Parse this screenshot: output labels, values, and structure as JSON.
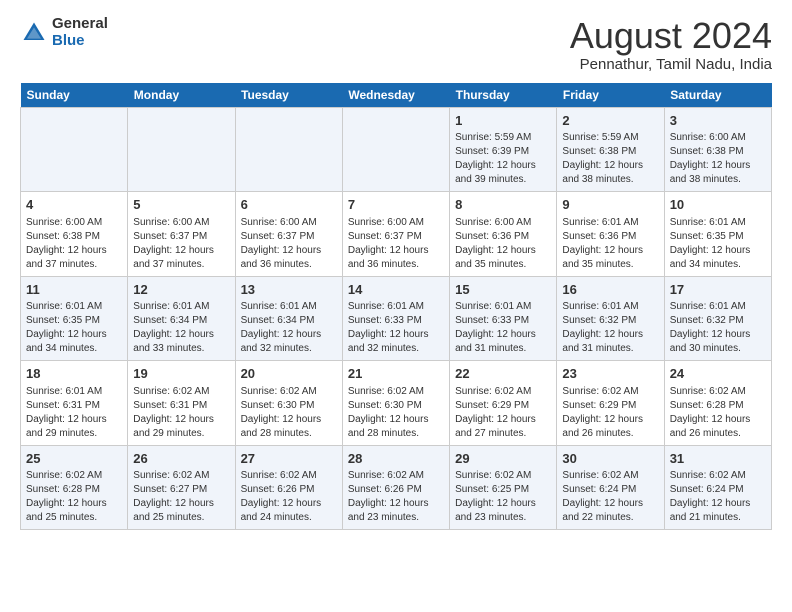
{
  "logo": {
    "general": "General",
    "blue": "Blue"
  },
  "header": {
    "title": "August 2024",
    "subtitle": "Pennathur, Tamil Nadu, India"
  },
  "weekdays": [
    "Sunday",
    "Monday",
    "Tuesday",
    "Wednesday",
    "Thursday",
    "Friday",
    "Saturday"
  ],
  "weeks": [
    [
      {
        "day": "",
        "info": ""
      },
      {
        "day": "",
        "info": ""
      },
      {
        "day": "",
        "info": ""
      },
      {
        "day": "",
        "info": ""
      },
      {
        "day": "1",
        "info": "Sunrise: 5:59 AM\nSunset: 6:39 PM\nDaylight: 12 hours\nand 39 minutes."
      },
      {
        "day": "2",
        "info": "Sunrise: 5:59 AM\nSunset: 6:38 PM\nDaylight: 12 hours\nand 38 minutes."
      },
      {
        "day": "3",
        "info": "Sunrise: 6:00 AM\nSunset: 6:38 PM\nDaylight: 12 hours\nand 38 minutes."
      }
    ],
    [
      {
        "day": "4",
        "info": "Sunrise: 6:00 AM\nSunset: 6:38 PM\nDaylight: 12 hours\nand 37 minutes."
      },
      {
        "day": "5",
        "info": "Sunrise: 6:00 AM\nSunset: 6:37 PM\nDaylight: 12 hours\nand 37 minutes."
      },
      {
        "day": "6",
        "info": "Sunrise: 6:00 AM\nSunset: 6:37 PM\nDaylight: 12 hours\nand 36 minutes."
      },
      {
        "day": "7",
        "info": "Sunrise: 6:00 AM\nSunset: 6:37 PM\nDaylight: 12 hours\nand 36 minutes."
      },
      {
        "day": "8",
        "info": "Sunrise: 6:00 AM\nSunset: 6:36 PM\nDaylight: 12 hours\nand 35 minutes."
      },
      {
        "day": "9",
        "info": "Sunrise: 6:01 AM\nSunset: 6:36 PM\nDaylight: 12 hours\nand 35 minutes."
      },
      {
        "day": "10",
        "info": "Sunrise: 6:01 AM\nSunset: 6:35 PM\nDaylight: 12 hours\nand 34 minutes."
      }
    ],
    [
      {
        "day": "11",
        "info": "Sunrise: 6:01 AM\nSunset: 6:35 PM\nDaylight: 12 hours\nand 34 minutes."
      },
      {
        "day": "12",
        "info": "Sunrise: 6:01 AM\nSunset: 6:34 PM\nDaylight: 12 hours\nand 33 minutes."
      },
      {
        "day": "13",
        "info": "Sunrise: 6:01 AM\nSunset: 6:34 PM\nDaylight: 12 hours\nand 32 minutes."
      },
      {
        "day": "14",
        "info": "Sunrise: 6:01 AM\nSunset: 6:33 PM\nDaylight: 12 hours\nand 32 minutes."
      },
      {
        "day": "15",
        "info": "Sunrise: 6:01 AM\nSunset: 6:33 PM\nDaylight: 12 hours\nand 31 minutes."
      },
      {
        "day": "16",
        "info": "Sunrise: 6:01 AM\nSunset: 6:32 PM\nDaylight: 12 hours\nand 31 minutes."
      },
      {
        "day": "17",
        "info": "Sunrise: 6:01 AM\nSunset: 6:32 PM\nDaylight: 12 hours\nand 30 minutes."
      }
    ],
    [
      {
        "day": "18",
        "info": "Sunrise: 6:01 AM\nSunset: 6:31 PM\nDaylight: 12 hours\nand 29 minutes."
      },
      {
        "day": "19",
        "info": "Sunrise: 6:02 AM\nSunset: 6:31 PM\nDaylight: 12 hours\nand 29 minutes."
      },
      {
        "day": "20",
        "info": "Sunrise: 6:02 AM\nSunset: 6:30 PM\nDaylight: 12 hours\nand 28 minutes."
      },
      {
        "day": "21",
        "info": "Sunrise: 6:02 AM\nSunset: 6:30 PM\nDaylight: 12 hours\nand 28 minutes."
      },
      {
        "day": "22",
        "info": "Sunrise: 6:02 AM\nSunset: 6:29 PM\nDaylight: 12 hours\nand 27 minutes."
      },
      {
        "day": "23",
        "info": "Sunrise: 6:02 AM\nSunset: 6:29 PM\nDaylight: 12 hours\nand 26 minutes."
      },
      {
        "day": "24",
        "info": "Sunrise: 6:02 AM\nSunset: 6:28 PM\nDaylight: 12 hours\nand 26 minutes."
      }
    ],
    [
      {
        "day": "25",
        "info": "Sunrise: 6:02 AM\nSunset: 6:28 PM\nDaylight: 12 hours\nand 25 minutes."
      },
      {
        "day": "26",
        "info": "Sunrise: 6:02 AM\nSunset: 6:27 PM\nDaylight: 12 hours\nand 25 minutes."
      },
      {
        "day": "27",
        "info": "Sunrise: 6:02 AM\nSunset: 6:26 PM\nDaylight: 12 hours\nand 24 minutes."
      },
      {
        "day": "28",
        "info": "Sunrise: 6:02 AM\nSunset: 6:26 PM\nDaylight: 12 hours\nand 23 minutes."
      },
      {
        "day": "29",
        "info": "Sunrise: 6:02 AM\nSunset: 6:25 PM\nDaylight: 12 hours\nand 23 minutes."
      },
      {
        "day": "30",
        "info": "Sunrise: 6:02 AM\nSunset: 6:24 PM\nDaylight: 12 hours\nand 22 minutes."
      },
      {
        "day": "31",
        "info": "Sunrise: 6:02 AM\nSunset: 6:24 PM\nDaylight: 12 hours\nand 21 minutes."
      }
    ]
  ]
}
